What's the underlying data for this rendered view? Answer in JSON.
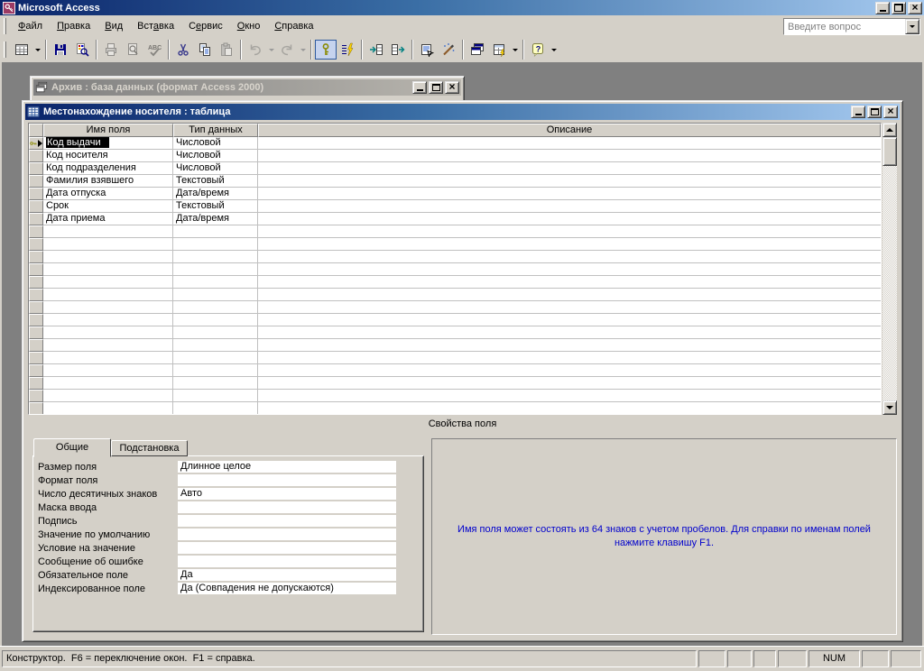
{
  "app": {
    "title": "Microsoft Access"
  },
  "menu": {
    "items": [
      {
        "label": "Файл",
        "u": 0
      },
      {
        "label": "Правка",
        "u": 0
      },
      {
        "label": "Вид",
        "u": 0
      },
      {
        "label": "Вставка",
        "u": 3
      },
      {
        "label": "Сервис",
        "u": 1
      },
      {
        "label": "Окно",
        "u": 0
      },
      {
        "label": "Справка",
        "u": 0
      }
    ],
    "question_box": "Введите вопрос"
  },
  "toolbar": {
    "buttons": [
      {
        "icon": "view-design",
        "dropdown": true
      },
      {
        "sep": true
      },
      {
        "icon": "save"
      },
      {
        "icon": "file-search"
      },
      {
        "sep": true
      },
      {
        "icon": "print",
        "disabled": true
      },
      {
        "icon": "print-preview",
        "disabled": true
      },
      {
        "icon": "spelling",
        "disabled": true
      },
      {
        "sep": true
      },
      {
        "icon": "cut"
      },
      {
        "icon": "copy"
      },
      {
        "icon": "paste",
        "disabled": true
      },
      {
        "sep": true
      },
      {
        "icon": "undo",
        "disabled": true,
        "dropdown": true
      },
      {
        "icon": "redo",
        "disabled": true,
        "dropdown": true
      },
      {
        "sep": true
      },
      {
        "icon": "primary-key",
        "pressed": true
      },
      {
        "icon": "indexes"
      },
      {
        "sep": true
      },
      {
        "icon": "insert-rows"
      },
      {
        "icon": "delete-rows"
      },
      {
        "sep": true
      },
      {
        "icon": "properties"
      },
      {
        "icon": "build"
      },
      {
        "sep": true
      },
      {
        "icon": "database-window"
      },
      {
        "icon": "new-object",
        "dropdown": true
      },
      {
        "sep": true
      },
      {
        "icon": "help",
        "dropdown": true
      }
    ]
  },
  "db_window": {
    "title": "Архив : база данных (формат Access 2000)"
  },
  "table_window": {
    "title": "Местонахождение носителя : таблица",
    "grid": {
      "headers": [
        "Имя поля",
        "Тип данных",
        "Описание"
      ],
      "rows": [
        {
          "name": "Код выдачи",
          "type": "Числовой",
          "desc": "",
          "selected": true,
          "primary_key": true
        },
        {
          "name": "Код носителя",
          "type": "Числовой",
          "desc": ""
        },
        {
          "name": "Код подразделения",
          "type": "Числовой",
          "desc": ""
        },
        {
          "name": "Фамилия взявшего",
          "type": "Текстовый",
          "desc": ""
        },
        {
          "name": "Дата отпуска",
          "type": "Дата/время",
          "desc": ""
        },
        {
          "name": "Срок",
          "type": "Текстовый",
          "desc": ""
        },
        {
          "name": "Дата приема",
          "type": "Дата/время",
          "desc": ""
        }
      ],
      "empty_rows": 15
    },
    "section_label": "Свойства поля",
    "tabs": [
      {
        "label": "Общие",
        "active": true
      },
      {
        "label": "Подстановка",
        "active": false
      }
    ],
    "properties": [
      {
        "label": "Размер поля",
        "value": "Длинное целое"
      },
      {
        "label": "Формат поля",
        "value": ""
      },
      {
        "label": "Число десятичных знаков",
        "value": "Авто"
      },
      {
        "label": "Маска ввода",
        "value": ""
      },
      {
        "label": "Подпись",
        "value": ""
      },
      {
        "label": "Значение по умолчанию",
        "value": ""
      },
      {
        "label": "Условие на значение",
        "value": ""
      },
      {
        "label": "Сообщение об ошибке",
        "value": ""
      },
      {
        "label": "Обязательное поле",
        "value": "Да"
      },
      {
        "label": "Индексированное поле",
        "value": "Да (Совпадения не допускаются)"
      }
    ],
    "help_text": "Имя поля может состоять из 64 знаков с учетом пробелов.  Для справки по именам полей нажмите клавишу F1."
  },
  "status": {
    "message": "Конструктор.  F6 = переключение окон.  F1 = справка.",
    "num": "NUM"
  },
  "colors": {
    "face": "#d4d0c8",
    "mdi_background": "#808080",
    "active_title_from": "#0a246a",
    "active_title_to": "#a6caf0",
    "inactive_title_from": "#808080",
    "inactive_title_to": "#b8b5ae",
    "selection": "#000000",
    "help_text": "#0000cc",
    "app_icon": "#9c3a64"
  }
}
